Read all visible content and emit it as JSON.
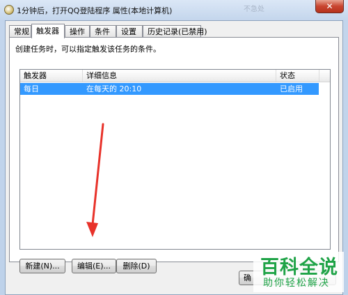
{
  "window": {
    "title": "1分钟后，打开QQ登陆程序 属性(本地计算机)",
    "close_glyph": "✕",
    "faint_header": "不急处"
  },
  "tabs": [
    {
      "label": "常规"
    },
    {
      "label": "触发器"
    },
    {
      "label": "操作"
    },
    {
      "label": "条件"
    },
    {
      "label": "设置"
    },
    {
      "label": "历史记录(已禁用)"
    }
  ],
  "active_tab": "触发器",
  "panel": {
    "description": "创建任务时，可以指定触发该任务的条件。"
  },
  "triggers_table": {
    "columns": [
      "触发器",
      "详细信息",
      "状态"
    ],
    "rows": [
      {
        "trigger": "每日",
        "details": "在每天的 20:10",
        "status": "已启用"
      }
    ]
  },
  "buttons": {
    "new": "新建(N)...",
    "edit": "编辑(E)...",
    "delete": "删除(D)",
    "ok_partial": "确"
  },
  "watermark": {
    "main": "百科全说",
    "sub": "助你轻松解决"
  },
  "colors": {
    "selection": "#3399ff",
    "arrow": "#e8322a",
    "watermark": "#1fa347"
  }
}
